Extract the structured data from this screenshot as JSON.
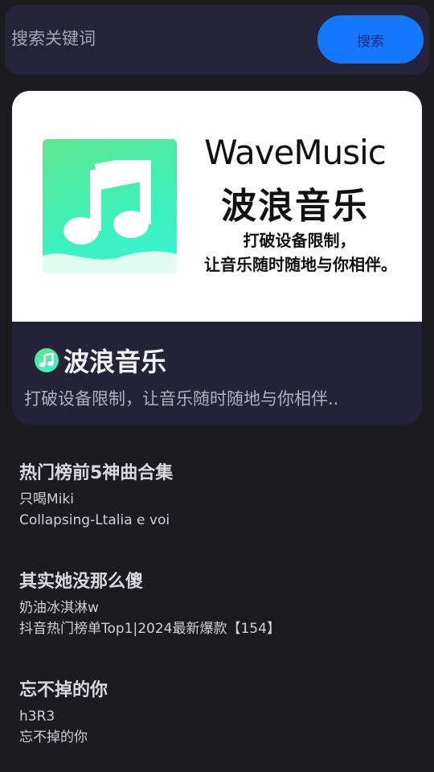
{
  "search": {
    "placeholder": "搜索关键词",
    "button_label": "搜索"
  },
  "banner": {
    "brand_en": "WaveMusic",
    "brand_cn": "波浪音乐",
    "slogan_line1": "打破设备限制，",
    "slogan_line2": "让音乐随时随地与你相伴。",
    "app_name": "波浪音乐",
    "description": "打破设备限制，让音乐随时随地与你相伴..",
    "icon": "music-note-icon"
  },
  "songs": [
    {
      "title": "热门榜前5神曲合集",
      "artist": "只喝Miki",
      "subtitle": "Collapsing-Ltalia e voi"
    },
    {
      "title": "其实她没那么傻",
      "artist": "奶油冰淇淋w",
      "subtitle": "抖音热门榜单Top1|2024最新爆款【154】"
    },
    {
      "title": "忘不掉的你",
      "artist": "h3R3",
      "subtitle": "忘不掉的你"
    }
  ],
  "colors": {
    "background": "#1c1b20",
    "accent": "#1677ff",
    "card": "#25233a",
    "logo_green": "#5fe68f"
  }
}
